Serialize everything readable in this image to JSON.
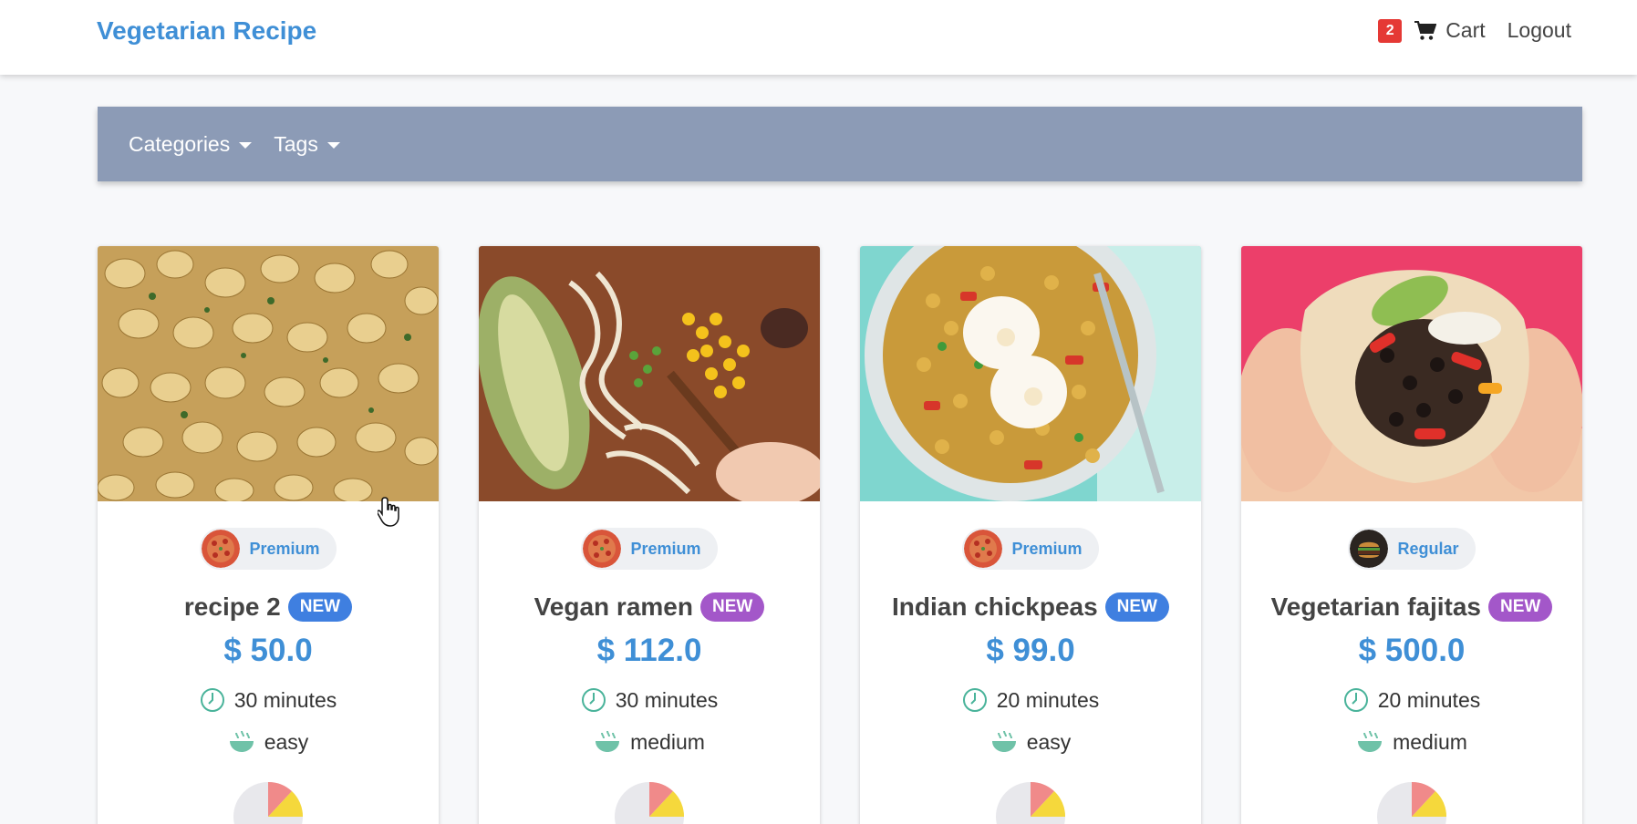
{
  "header": {
    "brand": "Vegetarian Recipe",
    "cart_count": "2",
    "cart_label": "Cart",
    "logout_label": "Logout"
  },
  "filters": {
    "categories_label": "Categories",
    "tags_label": "Tags"
  },
  "colors": {
    "accent": "#3f8fd6",
    "filterbar": "#8c9bb6",
    "badge_new_blue": "#3f7fe0",
    "badge_new_purple": "#a357c9",
    "cart_badge": "#e53935"
  },
  "recipes": [
    {
      "tier": "Premium",
      "title": "recipe 2",
      "new_label": "NEW",
      "price": "$ 50.0",
      "time": "30 minutes",
      "difficulty": "easy",
      "image_icon": "gnocchi-photo"
    },
    {
      "tier": "Premium",
      "title": "Vegan ramen",
      "new_label": "NEW",
      "price": "$ 112.0",
      "time": "30 minutes",
      "difficulty": "medium",
      "image_icon": "ramen-photo"
    },
    {
      "tier": "Premium",
      "title": "Indian chickpeas",
      "new_label": "NEW",
      "price": "$ 99.0",
      "time": "20 minutes",
      "difficulty": "easy",
      "image_icon": "chickpeas-photo"
    },
    {
      "tier": "Regular",
      "title": "Vegetarian fajitas",
      "new_label": "NEW",
      "price": "$ 500.0",
      "time": "20 minutes",
      "difficulty": "medium",
      "image_icon": "fajitas-photo"
    }
  ]
}
